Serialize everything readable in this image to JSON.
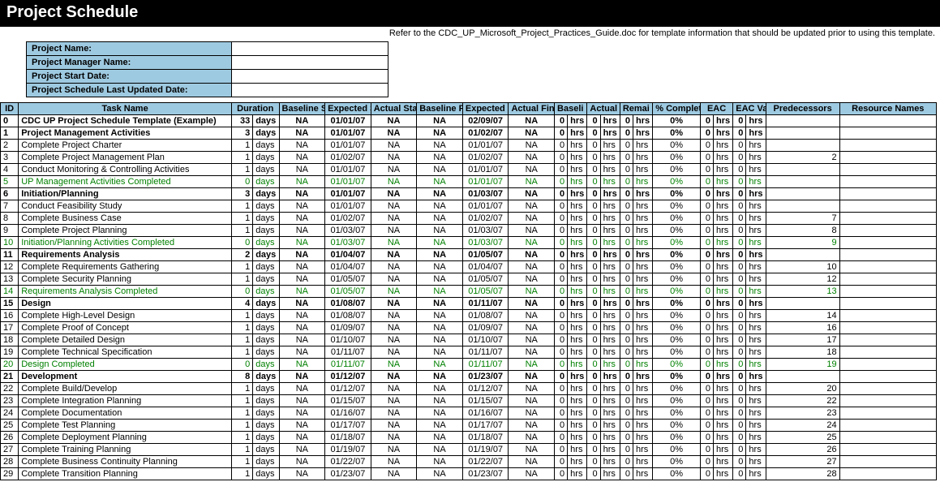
{
  "title": "Project Schedule",
  "note": "Refer to the CDC_UP_Microsoft_Project_Practices_Guide.doc for template information that should be updated prior to using this template.",
  "meta_labels": [
    "Project Name:",
    "Project Manager Name:",
    "Project Start Date:",
    "Project Schedule Last Updated Date:"
  ],
  "headers": {
    "id": "ID",
    "task": "Task Name",
    "duration": "Duration",
    "bstart": "Baseline Start",
    "estart": "Expected Start",
    "astart": "Actual Start",
    "bfin": "Baseline Finish",
    "efin": "Expected Finish",
    "afin": "Actual Finish",
    "baseline": "Baseli ne",
    "work": "Actual Work",
    "remain": "Remai nin g",
    "pct": "% Complete",
    "eac": "EAC",
    "eacv": "EAC Varia",
    "pred": "Predecessors",
    "res": "Resource Names"
  },
  "unit_days": "days",
  "unit_hrs": "hrs",
  "rows": [
    {
      "id": "0",
      "name": "CDC UP Project Schedule Template (Example)",
      "ind": 0,
      "dur": "33",
      "bs": "NA",
      "es": "01/01/07",
      "as": "NA",
      "bf": "NA",
      "ef": "02/09/07",
      "af": "NA",
      "bl": "0",
      "aw": "0",
      "rm": "0",
      "pc": "0%",
      "eac": "0",
      "ev": "0",
      "pd": "",
      "bold": true
    },
    {
      "id": "1",
      "name": "Project Management Activities",
      "ind": 1,
      "dur": "3",
      "bs": "NA",
      "es": "01/01/07",
      "as": "NA",
      "bf": "NA",
      "ef": "01/02/07",
      "af": "NA",
      "bl": "0",
      "aw": "0",
      "rm": "0",
      "pc": "0%",
      "eac": "0",
      "ev": "0",
      "pd": "",
      "bold": true
    },
    {
      "id": "2",
      "name": "Complete Project Charter",
      "ind": 2,
      "dur": "1",
      "bs": "NA",
      "es": "01/01/07",
      "as": "NA",
      "bf": "NA",
      "ef": "01/01/07",
      "af": "NA",
      "bl": "0",
      "aw": "0",
      "rm": "0",
      "pc": "0%",
      "eac": "0",
      "ev": "0",
      "pd": ""
    },
    {
      "id": "3",
      "name": "Complete Project Management Plan",
      "ind": 2,
      "dur": "1",
      "bs": "NA",
      "es": "01/02/07",
      "as": "NA",
      "bf": "NA",
      "ef": "01/02/07",
      "af": "NA",
      "bl": "0",
      "aw": "0",
      "rm": "0",
      "pc": "0%",
      "eac": "0",
      "ev": "0",
      "pd": "2"
    },
    {
      "id": "4",
      "name": "Conduct Monitoring & Controlling Activities",
      "ind": 2,
      "dur": "1",
      "bs": "NA",
      "es": "01/01/07",
      "as": "NA",
      "bf": "NA",
      "ef": "01/01/07",
      "af": "NA",
      "bl": "0",
      "aw": "0",
      "rm": "0",
      "pc": "0%",
      "eac": "0",
      "ev": "0",
      "pd": ""
    },
    {
      "id": "5",
      "name": "UP Management Activities Completed",
      "ind": 2,
      "dur": "0",
      "bs": "NA",
      "es": "01/01/07",
      "as": "NA",
      "bf": "NA",
      "ef": "01/01/07",
      "af": "NA",
      "bl": "0",
      "aw": "0",
      "rm": "0",
      "pc": "0%",
      "eac": "0",
      "ev": "0",
      "pd": "",
      "green": true
    },
    {
      "id": "6",
      "name": "Initiation/Planning",
      "ind": 1,
      "dur": "3",
      "bs": "NA",
      "es": "01/01/07",
      "as": "NA",
      "bf": "NA",
      "ef": "01/03/07",
      "af": "NA",
      "bl": "0",
      "aw": "0",
      "rm": "0",
      "pc": "0%",
      "eac": "0",
      "ev": "0",
      "pd": "",
      "bold": true
    },
    {
      "id": "7",
      "name": "Conduct Feasibility Study",
      "ind": 2,
      "dur": "1",
      "bs": "NA",
      "es": "01/01/07",
      "as": "NA",
      "bf": "NA",
      "ef": "01/01/07",
      "af": "NA",
      "bl": "0",
      "aw": "0",
      "rm": "0",
      "pc": "0%",
      "eac": "0",
      "ev": "0",
      "pd": ""
    },
    {
      "id": "8",
      "name": "Complete Business Case",
      "ind": 2,
      "dur": "1",
      "bs": "NA",
      "es": "01/02/07",
      "as": "NA",
      "bf": "NA",
      "ef": "01/02/07",
      "af": "NA",
      "bl": "0",
      "aw": "0",
      "rm": "0",
      "pc": "0%",
      "eac": "0",
      "ev": "0",
      "pd": "7"
    },
    {
      "id": "9",
      "name": "Complete Project Planning",
      "ind": 2,
      "dur": "1",
      "bs": "NA",
      "es": "01/03/07",
      "as": "NA",
      "bf": "NA",
      "ef": "01/03/07",
      "af": "NA",
      "bl": "0",
      "aw": "0",
      "rm": "0",
      "pc": "0%",
      "eac": "0",
      "ev": "0",
      "pd": "8"
    },
    {
      "id": "10",
      "name": "Initiation/Planning Activities Completed",
      "ind": 2,
      "dur": "0",
      "bs": "NA",
      "es": "01/03/07",
      "as": "NA",
      "bf": "NA",
      "ef": "01/03/07",
      "af": "NA",
      "bl": "0",
      "aw": "0",
      "rm": "0",
      "pc": "0%",
      "eac": "0",
      "ev": "0",
      "pd": "9",
      "green": true
    },
    {
      "id": "11",
      "name": "Requirements Analysis",
      "ind": 1,
      "dur": "2",
      "bs": "NA",
      "es": "01/04/07",
      "as": "NA",
      "bf": "NA",
      "ef": "01/05/07",
      "af": "NA",
      "bl": "0",
      "aw": "0",
      "rm": "0",
      "pc": "0%",
      "eac": "0",
      "ev": "0",
      "pd": "",
      "bold": true
    },
    {
      "id": "12",
      "name": "Complete Requirements Gathering",
      "ind": 2,
      "dur": "1",
      "bs": "NA",
      "es": "01/04/07",
      "as": "NA",
      "bf": "NA",
      "ef": "01/04/07",
      "af": "NA",
      "bl": "0",
      "aw": "0",
      "rm": "0",
      "pc": "0%",
      "eac": "0",
      "ev": "0",
      "pd": "10"
    },
    {
      "id": "13",
      "name": "Complete Security Planning",
      "ind": 2,
      "dur": "1",
      "bs": "NA",
      "es": "01/05/07",
      "as": "NA",
      "bf": "NA",
      "ef": "01/05/07",
      "af": "NA",
      "bl": "0",
      "aw": "0",
      "rm": "0",
      "pc": "0%",
      "eac": "0",
      "ev": "0",
      "pd": "12"
    },
    {
      "id": "14",
      "name": "Requirements Analysis Completed",
      "ind": 2,
      "dur": "0",
      "bs": "NA",
      "es": "01/05/07",
      "as": "NA",
      "bf": "NA",
      "ef": "01/05/07",
      "af": "NA",
      "bl": "0",
      "aw": "0",
      "rm": "0",
      "pc": "0%",
      "eac": "0",
      "ev": "0",
      "pd": "13",
      "green": true
    },
    {
      "id": "15",
      "name": "Design",
      "ind": 1,
      "dur": "4",
      "bs": "NA",
      "es": "01/08/07",
      "as": "NA",
      "bf": "NA",
      "ef": "01/11/07",
      "af": "NA",
      "bl": "0",
      "aw": "0",
      "rm": "0",
      "pc": "0%",
      "eac": "0",
      "ev": "0",
      "pd": "",
      "bold": true
    },
    {
      "id": "16",
      "name": "Complete High-Level Design",
      "ind": 2,
      "dur": "1",
      "bs": "NA",
      "es": "01/08/07",
      "as": "NA",
      "bf": "NA",
      "ef": "01/08/07",
      "af": "NA",
      "bl": "0",
      "aw": "0",
      "rm": "0",
      "pc": "0%",
      "eac": "0",
      "ev": "0",
      "pd": "14"
    },
    {
      "id": "17",
      "name": "Complete Proof of Concept",
      "ind": 2,
      "dur": "1",
      "bs": "NA",
      "es": "01/09/07",
      "as": "NA",
      "bf": "NA",
      "ef": "01/09/07",
      "af": "NA",
      "bl": "0",
      "aw": "0",
      "rm": "0",
      "pc": "0%",
      "eac": "0",
      "ev": "0",
      "pd": "16"
    },
    {
      "id": "18",
      "name": "Complete Detailed Design",
      "ind": 2,
      "dur": "1",
      "bs": "NA",
      "es": "01/10/07",
      "as": "NA",
      "bf": "NA",
      "ef": "01/10/07",
      "af": "NA",
      "bl": "0",
      "aw": "0",
      "rm": "0",
      "pc": "0%",
      "eac": "0",
      "ev": "0",
      "pd": "17"
    },
    {
      "id": "19",
      "name": "Complete Technical Specification",
      "ind": 2,
      "dur": "1",
      "bs": "NA",
      "es": "01/11/07",
      "as": "NA",
      "bf": "NA",
      "ef": "01/11/07",
      "af": "NA",
      "bl": "0",
      "aw": "0",
      "rm": "0",
      "pc": "0%",
      "eac": "0",
      "ev": "0",
      "pd": "18"
    },
    {
      "id": "20",
      "name": "Design Completed",
      "ind": 2,
      "dur": "0",
      "bs": "NA",
      "es": "01/11/07",
      "as": "NA",
      "bf": "NA",
      "ef": "01/11/07",
      "af": "NA",
      "bl": "0",
      "aw": "0",
      "rm": "0",
      "pc": "0%",
      "eac": "0",
      "ev": "0",
      "pd": "19",
      "green": true
    },
    {
      "id": "21",
      "name": "Development",
      "ind": 1,
      "dur": "8",
      "bs": "NA",
      "es": "01/12/07",
      "as": "NA",
      "bf": "NA",
      "ef": "01/23/07",
      "af": "NA",
      "bl": "0",
      "aw": "0",
      "rm": "0",
      "pc": "0%",
      "eac": "0",
      "ev": "0",
      "pd": "",
      "bold": true
    },
    {
      "id": "22",
      "name": "Complete Build/Develop",
      "ind": 2,
      "dur": "1",
      "bs": "NA",
      "es": "01/12/07",
      "as": "NA",
      "bf": "NA",
      "ef": "01/12/07",
      "af": "NA",
      "bl": "0",
      "aw": "0",
      "rm": "0",
      "pc": "0%",
      "eac": "0",
      "ev": "0",
      "pd": "20"
    },
    {
      "id": "23",
      "name": "Complete Integration Planning",
      "ind": 2,
      "dur": "1",
      "bs": "NA",
      "es": "01/15/07",
      "as": "NA",
      "bf": "NA",
      "ef": "01/15/07",
      "af": "NA",
      "bl": "0",
      "aw": "0",
      "rm": "0",
      "pc": "0%",
      "eac": "0",
      "ev": "0",
      "pd": "22"
    },
    {
      "id": "24",
      "name": "Complete Documentation",
      "ind": 2,
      "dur": "1",
      "bs": "NA",
      "es": "01/16/07",
      "as": "NA",
      "bf": "NA",
      "ef": "01/16/07",
      "af": "NA",
      "bl": "0",
      "aw": "0",
      "rm": "0",
      "pc": "0%",
      "eac": "0",
      "ev": "0",
      "pd": "23"
    },
    {
      "id": "25",
      "name": "Complete Test Planning",
      "ind": 2,
      "dur": "1",
      "bs": "NA",
      "es": "01/17/07",
      "as": "NA",
      "bf": "NA",
      "ef": "01/17/07",
      "af": "NA",
      "bl": "0",
      "aw": "0",
      "rm": "0",
      "pc": "0%",
      "eac": "0",
      "ev": "0",
      "pd": "24"
    },
    {
      "id": "26",
      "name": "Complete Deployment Planning",
      "ind": 2,
      "dur": "1",
      "bs": "NA",
      "es": "01/18/07",
      "as": "NA",
      "bf": "NA",
      "ef": "01/18/07",
      "af": "NA",
      "bl": "0",
      "aw": "0",
      "rm": "0",
      "pc": "0%",
      "eac": "0",
      "ev": "0",
      "pd": "25"
    },
    {
      "id": "27",
      "name": "Complete Training Planning",
      "ind": 2,
      "dur": "1",
      "bs": "NA",
      "es": "01/19/07",
      "as": "NA",
      "bf": "NA",
      "ef": "01/19/07",
      "af": "NA",
      "bl": "0",
      "aw": "0",
      "rm": "0",
      "pc": "0%",
      "eac": "0",
      "ev": "0",
      "pd": "26"
    },
    {
      "id": "28",
      "name": "Complete Business Continuity Planning",
      "ind": 2,
      "dur": "1",
      "bs": "NA",
      "es": "01/22/07",
      "as": "NA",
      "bf": "NA",
      "ef": "01/22/07",
      "af": "NA",
      "bl": "0",
      "aw": "0",
      "rm": "0",
      "pc": "0%",
      "eac": "0",
      "ev": "0",
      "pd": "27"
    },
    {
      "id": "29",
      "name": "Complete Transition Planning",
      "ind": 2,
      "dur": "1",
      "bs": "NA",
      "es": "01/23/07",
      "as": "NA",
      "bf": "NA",
      "ef": "01/23/07",
      "af": "NA",
      "bl": "0",
      "aw": "0",
      "rm": "0",
      "pc": "0%",
      "eac": "0",
      "ev": "0",
      "pd": "28"
    }
  ]
}
